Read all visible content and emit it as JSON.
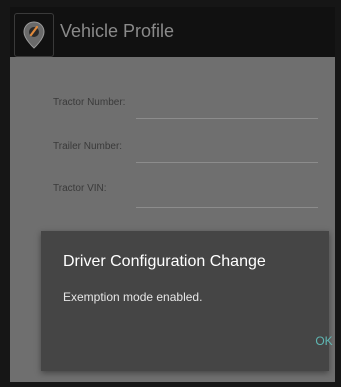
{
  "appbar": {
    "title": "Vehicle Profile",
    "icon": "location-pin-icon"
  },
  "form": {
    "fields": [
      {
        "label": "Tractor Number:",
        "value": ""
      },
      {
        "label": "Trailer Number:",
        "value": ""
      },
      {
        "label": "Tractor VIN:",
        "value": ""
      }
    ]
  },
  "dialog": {
    "title": "Driver Configuration Change",
    "message": "Exemption mode enabled.",
    "ok_label": "OK"
  },
  "colors": {
    "appbar": "#111111",
    "scrim_background": "#6f6f6f",
    "dialog_background": "#454545",
    "accent": "#5fb7b3",
    "pin_orange": "#e08a3c"
  }
}
